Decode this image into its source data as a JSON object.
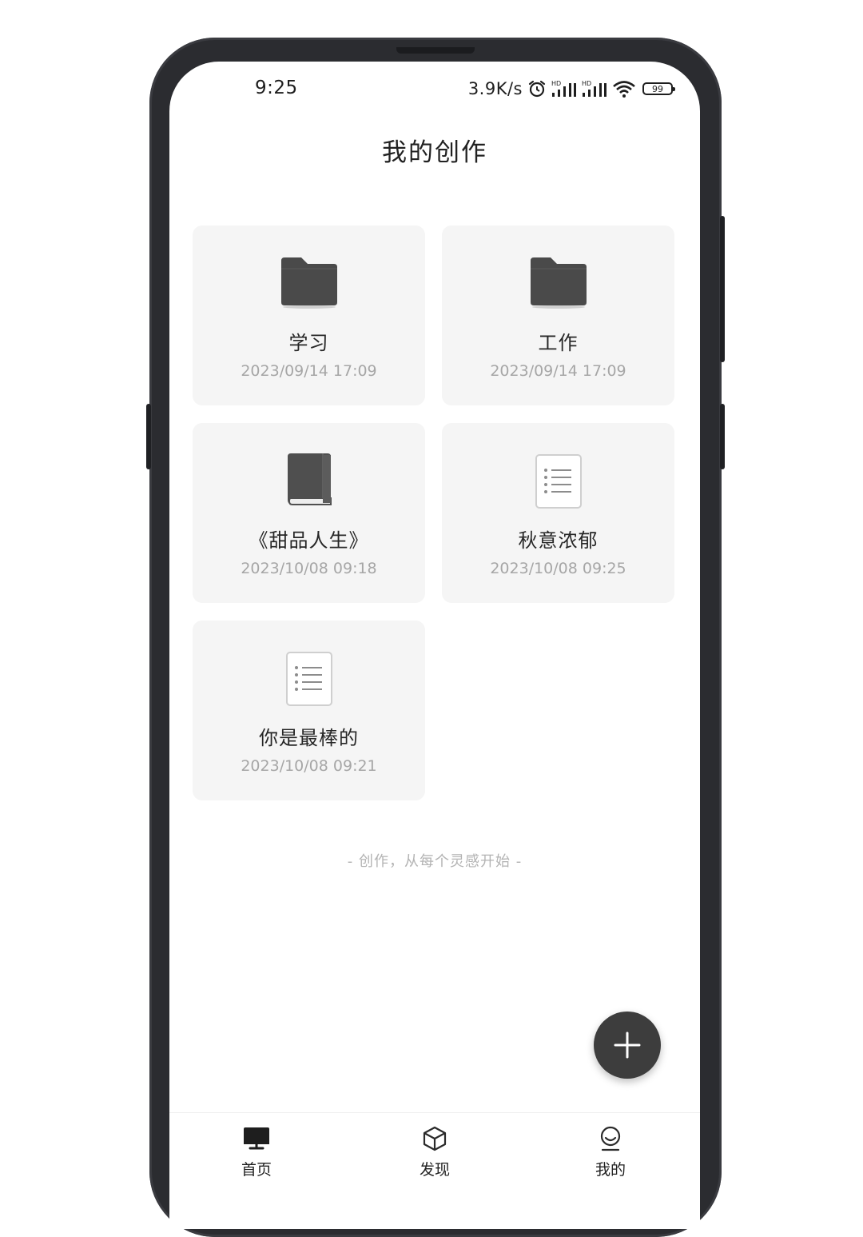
{
  "status_bar": {
    "time": "9:25",
    "net_speed": "3.9K/s",
    "battery": "99",
    "icons": [
      "alarm-icon",
      "signal-hd-icon",
      "signal-hd-icon",
      "wifi-icon",
      "battery-icon"
    ]
  },
  "header": {
    "title": "我的创作"
  },
  "cards": [
    {
      "name": "学习",
      "time": "2023/09/14 17:09",
      "icon": "folder-icon"
    },
    {
      "name": "工作",
      "time": "2023/09/14 17:09",
      "icon": "folder-icon"
    },
    {
      "name": "《甜品人生》",
      "time": "2023/10/08 09:18",
      "icon": "book-icon"
    },
    {
      "name": "秋意浓郁",
      "time": "2023/10/08 09:25",
      "icon": "document-icon"
    },
    {
      "name": "你是最棒的",
      "time": "2023/10/08 09:21",
      "icon": "document-icon"
    }
  ],
  "slogan": "- 创作，从每个灵感开始 -",
  "fab": {
    "icon": "plus-icon"
  },
  "bottom_nav": [
    {
      "label": "首页",
      "icon": "monitor-icon"
    },
    {
      "label": "发现",
      "icon": "cube-icon"
    },
    {
      "label": "我的",
      "icon": "user-icon"
    }
  ],
  "colors": {
    "card_bg": "#f5f5f5",
    "fab_bg": "#3d3d3d",
    "folder": "#4a4a4a",
    "muted_text": "#a6a6a6"
  }
}
